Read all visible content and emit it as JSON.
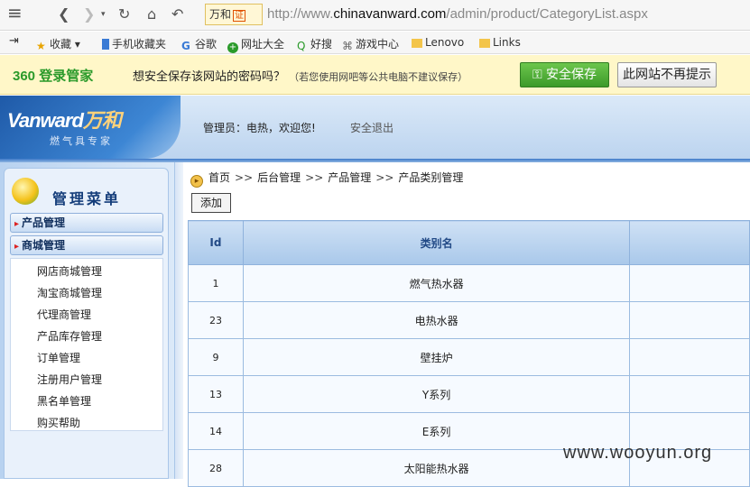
{
  "browser": {
    "site_badge": "万和",
    "site_badge_tag": "证",
    "url_prefix": "http://www.",
    "url_domain": "chinavanward.com",
    "url_path": "/admin/product/CategoryList.aspx"
  },
  "favorites": [
    {
      "label": "收藏",
      "icon": "star-icon"
    },
    {
      "label": "手机收藏夹",
      "icon": "phone-icon"
    },
    {
      "label": "谷歌",
      "icon": "google-icon"
    },
    {
      "label": "网址大全",
      "icon": "plus-icon"
    },
    {
      "label": "好搜",
      "icon": "search-icon"
    },
    {
      "label": "游戏中心",
      "icon": "gamepad-icon"
    },
    {
      "label": "Lenovo",
      "icon": "folder-icon"
    },
    {
      "label": "Links",
      "icon": "folder-icon"
    }
  ],
  "password_bar": {
    "logo": "360 登录管家",
    "message": "想安全保存该网站的密码吗？",
    "note": "（若您使用网吧等公共电脑不建议保存）",
    "save_label": "安全保存",
    "never_label": "此网站不再提示"
  },
  "header": {
    "logo": "Vanward",
    "logo_cn": "万和",
    "logo_sub": "燃气具专家",
    "welcome": "管理员：电热，欢迎您!",
    "logout": "安全退出"
  },
  "sidebar": {
    "title": "管理菜单",
    "groups": [
      {
        "label": "产品管理"
      },
      {
        "label": "商城管理"
      }
    ],
    "items": [
      {
        "label": "网店商城管理"
      },
      {
        "label": "淘宝商城管理"
      },
      {
        "label": "代理商管理"
      },
      {
        "label": "产品库存管理"
      },
      {
        "label": "订单管理"
      },
      {
        "label": "注册用户管理"
      },
      {
        "label": "黑名单管理"
      },
      {
        "label": "购买帮助"
      }
    ]
  },
  "breadcrumb": [
    "首页",
    "后台管理",
    "产品管理",
    "产品类别管理"
  ],
  "add_label": "添加",
  "table": {
    "columns": [
      "Id",
      "类别名",
      ""
    ],
    "rows": [
      {
        "id": "1",
        "name": "燃气热水器"
      },
      {
        "id": "23",
        "name": "电热水器"
      },
      {
        "id": "9",
        "name": "壁挂炉"
      },
      {
        "id": "13",
        "name": "Y系列"
      },
      {
        "id": "14",
        "name": "E系列"
      },
      {
        "id": "28",
        "name": "太阳能热水器"
      }
    ]
  },
  "watermark": "www.wooyun.org",
  "colors": {
    "accent": "#3d86d4",
    "save_green": "#3c9a2a"
  }
}
